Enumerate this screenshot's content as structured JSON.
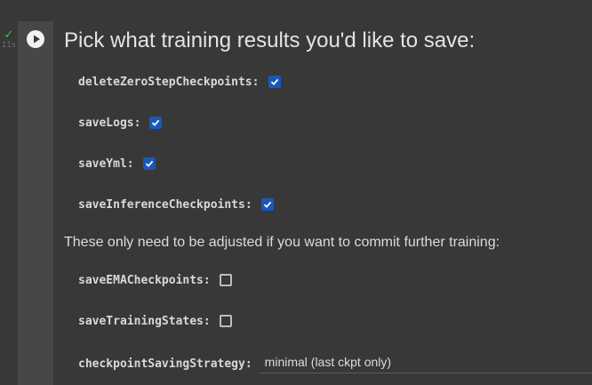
{
  "cell": {
    "status_check": "✓",
    "exec_time": "11s",
    "run_icon": "play-icon"
  },
  "form": {
    "heading": "Pick what training results you'd like to save:",
    "section_note": "These only need to be adjusted if you want to commit further training:",
    "fields": [
      {
        "label": "deleteZeroStepCheckpoints:",
        "checked": true
      },
      {
        "label": "saveLogs:",
        "checked": true
      },
      {
        "label": "saveYml:",
        "checked": true
      },
      {
        "label": "saveInferenceCheckpoints:",
        "checked": true
      },
      {
        "label": "saveEMACheckpoints:",
        "checked": false
      },
      {
        "label": "saveTrainingStates:",
        "checked": false
      }
    ],
    "strategy": {
      "label": "checkpointSavingStrategy:",
      "value": "minimal (last ckpt only)"
    }
  },
  "colors": {
    "checkbox_checked": "#1a57b8",
    "status_ok": "#3fb950",
    "background": "#383838"
  }
}
